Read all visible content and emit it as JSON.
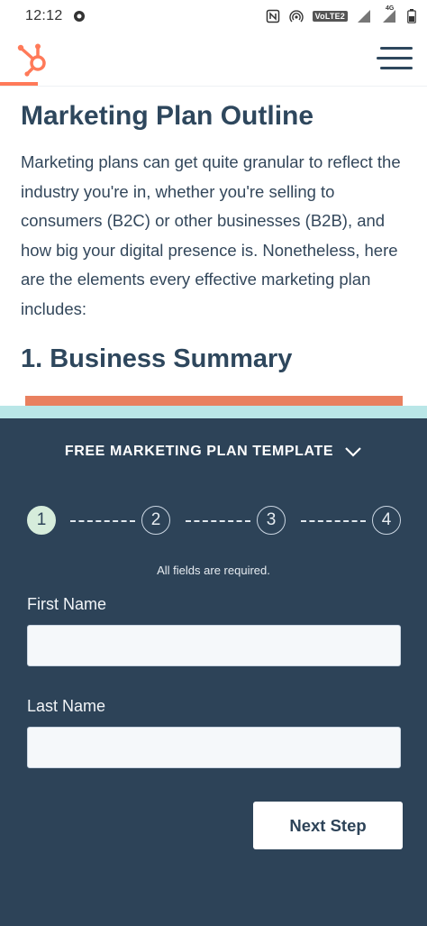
{
  "status_bar": {
    "time": "12:12",
    "network_badge": "VoLTE2",
    "network_type": "4G"
  },
  "header": {
    "logo_icon": "hubspot-sprocket-icon",
    "menu_icon": "hamburger-menu-icon"
  },
  "article": {
    "title": "Marketing Plan Outline",
    "body": "Marketing plans can get quite granular to reflect the industry you're in, whether you're selling to consumers (B2C) or other businesses (B2B), and how big your digital presence is. Nonetheless, here are the elements every effective marketing plan includes:",
    "section_heading": "1. Business Summary"
  },
  "form": {
    "toggle_label": "FREE MARKETING PLAN TEMPLATE",
    "steps": [
      "1",
      "2",
      "3",
      "4"
    ],
    "active_step": 1,
    "required_note": "All fields are required.",
    "first_name_label": "First Name",
    "first_name_value": "",
    "last_name_label": "Last Name",
    "last_name_value": "",
    "next_button_label": "Next Step"
  },
  "colors": {
    "brand_orange": "#ff7a59",
    "panel_navy": "#2d4358",
    "heading_navy": "#2e475d",
    "active_step_green": "#d6ecdb",
    "accent_teal": "#b9e6e7"
  }
}
